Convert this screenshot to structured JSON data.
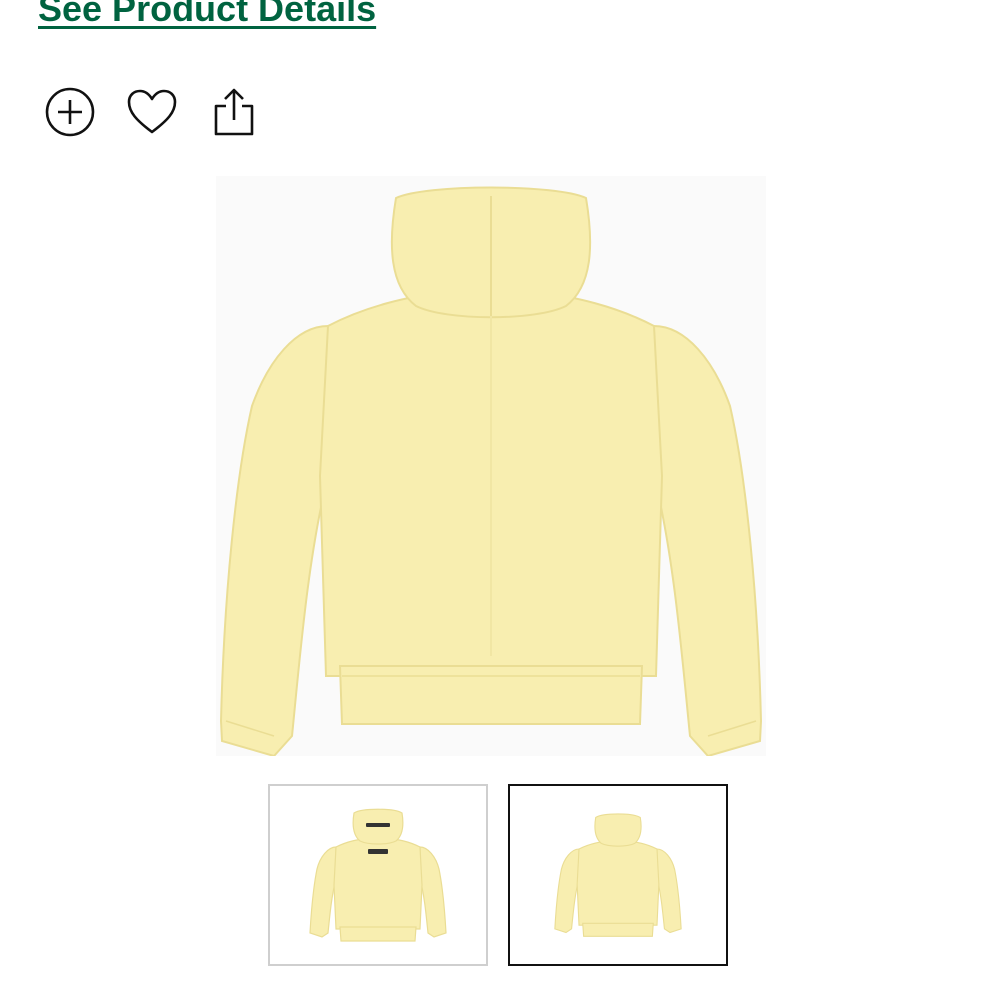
{
  "product": {
    "details_link": "See Product Details"
  },
  "actions": {
    "items": [
      {
        "icon": "add-circle-icon"
      },
      {
        "icon": "heart-icon"
      },
      {
        "icon": "share-icon"
      }
    ]
  },
  "gallery": {
    "selected_index": 1,
    "thumbnails": [
      {
        "view": "back-with-label"
      },
      {
        "view": "back"
      }
    ]
  },
  "colors": {
    "link": "#006340",
    "hoodie": "#f8eeb0",
    "hoodie_shade": "#ede19a",
    "selected_border": "#111111",
    "thumb_border": "#cfcfcf"
  }
}
